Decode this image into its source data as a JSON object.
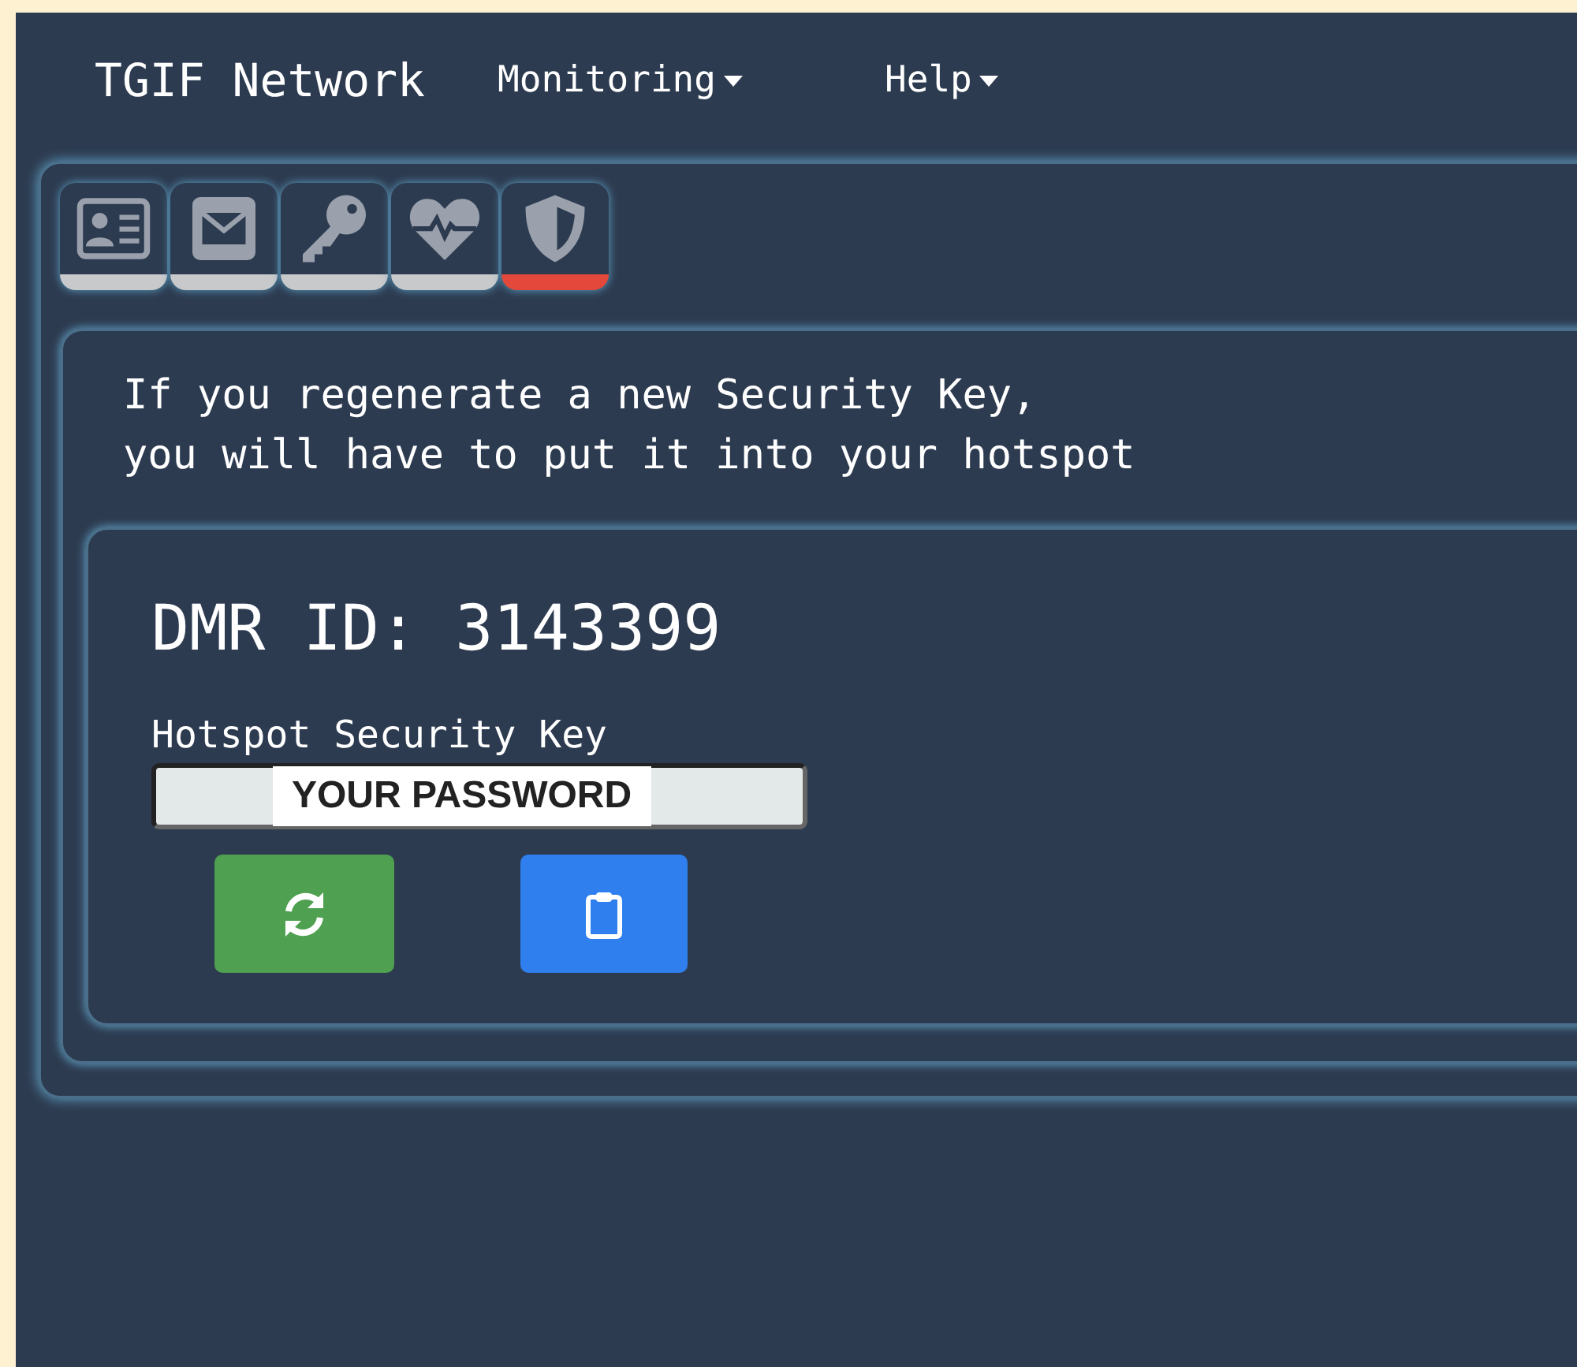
{
  "navbar": {
    "brand": "TGIF Network",
    "menus": [
      {
        "label": "Monitoring"
      },
      {
        "label": "Help"
      }
    ]
  },
  "tabs": [
    {
      "kind": "id-card",
      "selected": false
    },
    {
      "kind": "envelope",
      "selected": false
    },
    {
      "kind": "key",
      "selected": false
    },
    {
      "kind": "heartbeat",
      "selected": false
    },
    {
      "kind": "shield",
      "selected": true
    }
  ],
  "notice": "If you regenerate a new Security Key,\nyou will have to put it into your hotspot",
  "dmr_id": "DMR ID: 3143399",
  "key_field": {
    "label": "Hotspot Security Key",
    "value": "YOUR PASSWORD"
  },
  "buttons": [
    {
      "kind": "regenerate"
    },
    {
      "kind": "copy"
    }
  ]
}
